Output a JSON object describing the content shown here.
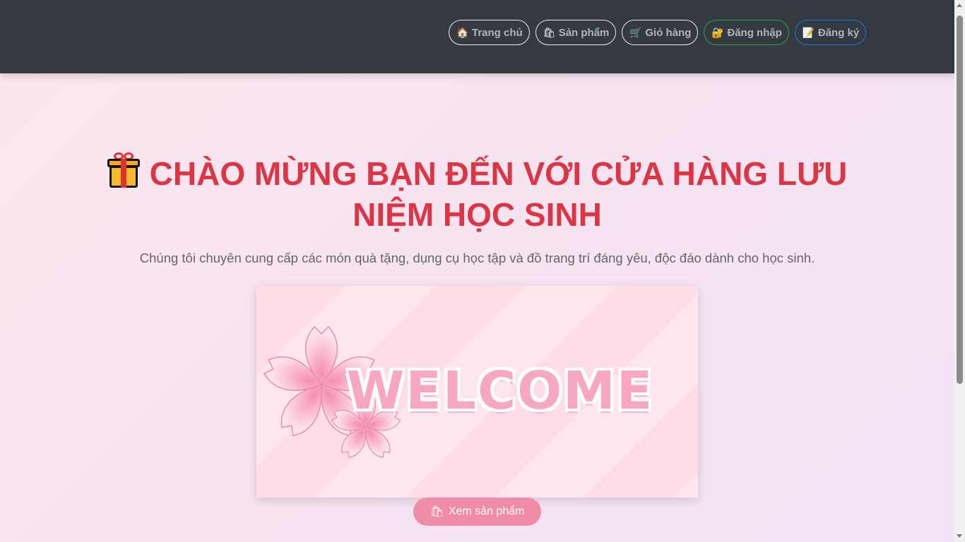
{
  "nav": {
    "items": [
      {
        "icon": "house-icon",
        "glyph": "🏠",
        "label": "Trang chủ"
      },
      {
        "icon": "shopping-bags-icon",
        "glyph": "🛍",
        "label": "Sản phẩm"
      },
      {
        "icon": "cart-icon",
        "glyph": "🛒",
        "label": "Giỏ hàng"
      },
      {
        "icon": "lock-icon",
        "glyph": "🔐",
        "label": "Đăng nhập"
      },
      {
        "icon": "memo-icon",
        "glyph": "📝",
        "label": "Đăng ký"
      }
    ]
  },
  "hero": {
    "title": "CHÀO MỪNG BẠN ĐẾN VỚI CỬA HÀNG LƯU NIỆM HỌC SINH",
    "subtitle": "Chúng tôi chuyên cung cấp các món quà tặng, dụng cụ học tập và đồ trang trí đáng yêu, độc đáo dành cho học sinh.",
    "banner_text": "WELCOME",
    "cta_icon": "shopping-bags-icon",
    "cta_glyph": "🛍",
    "cta_label": "Xem sản phẩm"
  },
  "colors": {
    "navbar": "#343a40",
    "title": "#dc3545",
    "cta": "#f08ba8",
    "login_border": "#28a745",
    "register_border": "#1a73e8"
  }
}
